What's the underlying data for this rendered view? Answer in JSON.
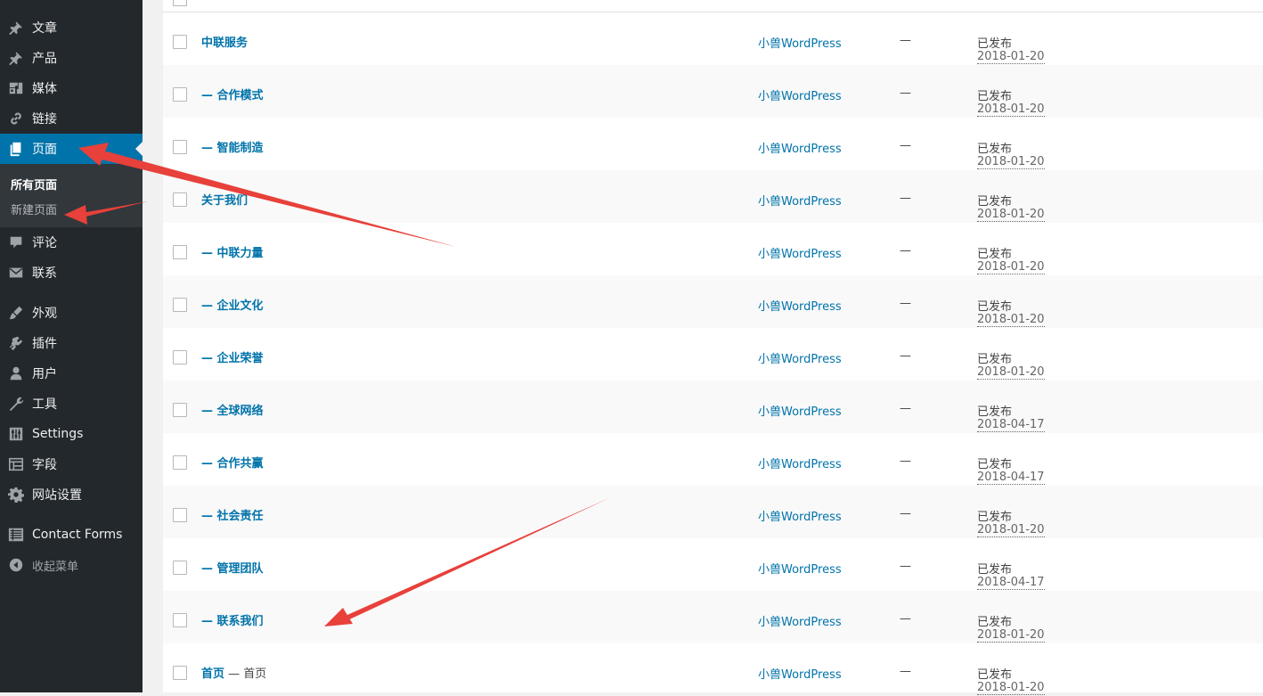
{
  "sidebar": {
    "items": [
      {
        "label": "文章",
        "icon": "pushpin-icon"
      },
      {
        "label": "产品",
        "icon": "pushpin-icon"
      },
      {
        "label": "媒体",
        "icon": "media-icon"
      },
      {
        "label": "链接",
        "icon": "link-icon"
      },
      {
        "label": "页面",
        "icon": "page-icon"
      },
      {
        "label": "评论",
        "icon": "comment-icon"
      },
      {
        "label": "联系",
        "icon": "mail-icon"
      },
      {
        "label": "外观",
        "icon": "brush-icon"
      },
      {
        "label": "插件",
        "icon": "plugin-icon"
      },
      {
        "label": "用户",
        "icon": "user-icon"
      },
      {
        "label": "工具",
        "icon": "wrench-icon"
      },
      {
        "label": "Settings",
        "icon": "settings-icon"
      },
      {
        "label": "字段",
        "icon": "fields-icon"
      },
      {
        "label": "网站设置",
        "icon": "gear-icon"
      },
      {
        "label": "Contact Forms",
        "icon": "forms-icon"
      },
      {
        "label": "收起菜单",
        "icon": "collapse-icon"
      }
    ],
    "submenu": [
      {
        "label": "所有页面"
      },
      {
        "label": "新建页面"
      }
    ]
  },
  "table": {
    "rows": [
      {
        "title": "中联服务",
        "title_suffix": "",
        "author": "小兽WordPress",
        "comments": "—",
        "status": "已发布",
        "date": "2018-01-20"
      },
      {
        "title": "— 合作模式",
        "title_suffix": "",
        "author": "小兽WordPress",
        "comments": "—",
        "status": "已发布",
        "date": "2018-01-20"
      },
      {
        "title": "— 智能制造",
        "title_suffix": "",
        "author": "小兽WordPress",
        "comments": "—",
        "status": "已发布",
        "date": "2018-01-20"
      },
      {
        "title": "关于我们",
        "title_suffix": "",
        "author": "小兽WordPress",
        "comments": "—",
        "status": "已发布",
        "date": "2018-01-20"
      },
      {
        "title": "— 中联力量",
        "title_suffix": "",
        "author": "小兽WordPress",
        "comments": "—",
        "status": "已发布",
        "date": "2018-01-20"
      },
      {
        "title": "— 企业文化",
        "title_suffix": "",
        "author": "小兽WordPress",
        "comments": "—",
        "status": "已发布",
        "date": "2018-01-20"
      },
      {
        "title": "— 企业荣誉",
        "title_suffix": "",
        "author": "小兽WordPress",
        "comments": "—",
        "status": "已发布",
        "date": "2018-01-20"
      },
      {
        "title": "— 全球网络",
        "title_suffix": "",
        "author": "小兽WordPress",
        "comments": "—",
        "status": "已发布",
        "date": "2018-04-17"
      },
      {
        "title": "— 合作共赢",
        "title_suffix": "",
        "author": "小兽WordPress",
        "comments": "—",
        "status": "已发布",
        "date": "2018-04-17"
      },
      {
        "title": "— 社会责任",
        "title_suffix": "",
        "author": "小兽WordPress",
        "comments": "—",
        "status": "已发布",
        "date": "2018-01-20"
      },
      {
        "title": "— 管理团队",
        "title_suffix": "",
        "author": "小兽WordPress",
        "comments": "—",
        "status": "已发布",
        "date": "2018-04-17"
      },
      {
        "title": "— 联系我们",
        "title_suffix": "",
        "author": "小兽WordPress",
        "comments": "—",
        "status": "已发布",
        "date": "2018-01-20"
      },
      {
        "title": "首页",
        "title_suffix": " — 首页",
        "author": "小兽WordPress",
        "comments": "—",
        "status": "已发布",
        "date": "2018-01-20"
      }
    ]
  },
  "colors": {
    "sidebar_bg": "#23282d",
    "active_bg": "#0073aa",
    "link": "#0073aa",
    "annotation_arrow": "#e8403a"
  }
}
